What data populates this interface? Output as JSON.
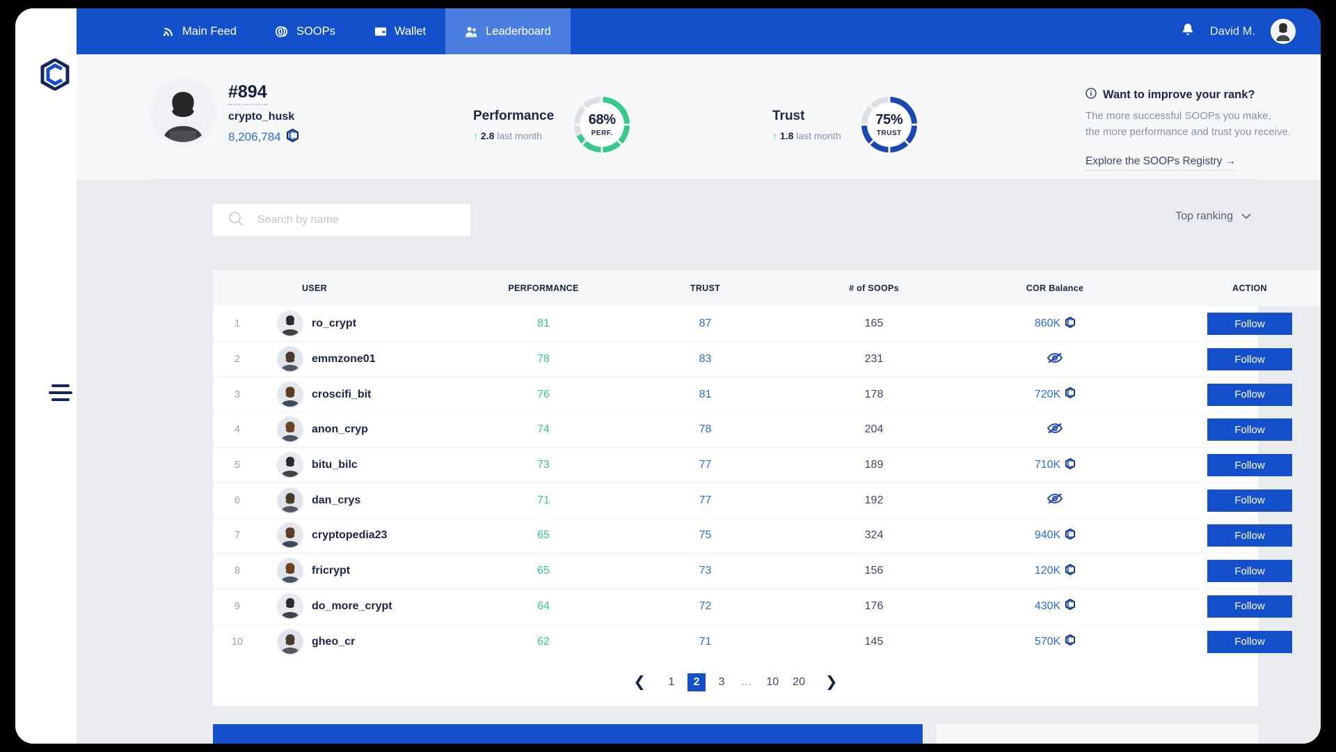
{
  "brand": {
    "logo_icon": "cor-hex-logo",
    "menu_icon": "hamburger-menu-icon",
    "accent": "#1450cb",
    "green": "#35c98b"
  },
  "nav": {
    "tabs": [
      {
        "label": "Main Feed",
        "icon": "rss-feed-icon",
        "active": false
      },
      {
        "label": "SOOPs",
        "icon": "coins-icon",
        "active": false
      },
      {
        "label": "Wallet",
        "icon": "wallet-icon",
        "active": false
      },
      {
        "label": "Leaderboard",
        "icon": "leaderboard-people-icon",
        "active": true
      }
    ],
    "notifications_icon": "bell-icon",
    "user_name": "David M.",
    "user_avatar": "user-avatar"
  },
  "profile": {
    "avatar": "profile-avatar",
    "rank": "#894",
    "handle": "crypto_husk",
    "balance": "8,206,784",
    "balance_icon": "cor-coin-icon"
  },
  "metrics": [
    {
      "label": "Performance",
      "delta_arrow": "↑",
      "delta": "2.8",
      "period": "last month",
      "percent": "68%",
      "short": "PERF.",
      "value": 68,
      "color": "#35c98b"
    },
    {
      "label": "Trust",
      "delta_arrow": "↑",
      "delta": "1.8",
      "period": "last month",
      "percent": "75%",
      "short": "TRUST",
      "value": 75,
      "color": "#1b47b5"
    }
  ],
  "promo": {
    "icon": "info-circle-icon",
    "title": "Want to improve your rank?",
    "body": "The more successful SOOPs you make,\nthe more performance and trust you receive.",
    "link": "Explore the SOOPs Registry",
    "link_arrow": "→"
  },
  "search": {
    "icon": "search-icon",
    "placeholder": "Search by name",
    "value": ""
  },
  "sort": {
    "label": "Top ranking",
    "icon": "chevron-down-icon"
  },
  "table": {
    "columns": [
      "",
      "USER",
      "PERFORMANCE",
      "TRUST",
      "# of SOOPs",
      "COR Balance",
      "ACTION"
    ],
    "action_label": "Follow",
    "hidden_icon": "eye-off-icon",
    "rows": [
      {
        "rank": "1",
        "user": "ro_crypt",
        "performance": "81",
        "trust": "87",
        "soops": "165",
        "cor": "860K",
        "cor_hidden": false
      },
      {
        "rank": "2",
        "user": "emmzone01",
        "performance": "78",
        "trust": "83",
        "soops": "231",
        "cor": "",
        "cor_hidden": true
      },
      {
        "rank": "3",
        "user": "croscifi_bit",
        "performance": "76",
        "trust": "81",
        "soops": "178",
        "cor": "720K",
        "cor_hidden": false
      },
      {
        "rank": "4",
        "user": "anon_cryp",
        "performance": "74",
        "trust": "78",
        "soops": "204",
        "cor": "",
        "cor_hidden": true
      },
      {
        "rank": "5",
        "user": "bitu_bilc",
        "performance": "73",
        "trust": "77",
        "soops": "189",
        "cor": "710K",
        "cor_hidden": false
      },
      {
        "rank": "6",
        "user": "dan_crys",
        "performance": "71",
        "trust": "77",
        "soops": "192",
        "cor": "",
        "cor_hidden": true
      },
      {
        "rank": "7",
        "user": "cryptopedia23",
        "performance": "65",
        "trust": "75",
        "soops": "324",
        "cor": "940K",
        "cor_hidden": false
      },
      {
        "rank": "8",
        "user": "fricrypt",
        "performance": "65",
        "trust": "73",
        "soops": "156",
        "cor": "120K",
        "cor_hidden": false
      },
      {
        "rank": "9",
        "user": "do_more_crypt",
        "performance": "64",
        "trust": "72",
        "soops": "176",
        "cor": "430K",
        "cor_hidden": false
      },
      {
        "rank": "10",
        "user": "gheo_cr",
        "performance": "62",
        "trust": "71",
        "soops": "145",
        "cor": "570K",
        "cor_hidden": false
      }
    ]
  },
  "pagination": {
    "prev_icon": "chevron-left-icon",
    "next_icon": "chevron-right-icon",
    "pages": [
      "1",
      "2",
      "3",
      "…",
      "10",
      "20"
    ],
    "current": "2"
  }
}
